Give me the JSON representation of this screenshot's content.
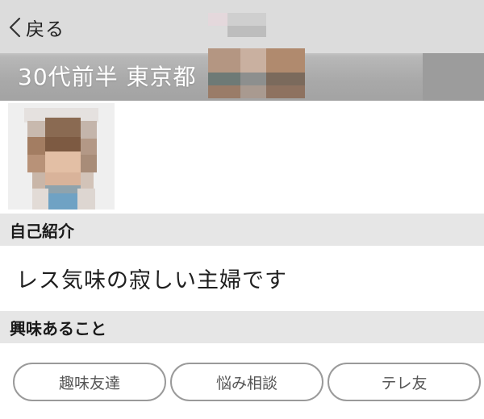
{
  "header": {
    "back_label": "戻る",
    "profile_title": "30代前半 東京都"
  },
  "sections": {
    "intro_heading": "自己紹介",
    "intro_text": "レス気味の寂しい主婦です",
    "interests_heading": "興味あること"
  },
  "interests": [
    "趣味友達",
    "悩み相談",
    "テレ友"
  ],
  "colors": {
    "header_bg": "#d9d9d9",
    "section_bg": "#e6e6e6",
    "tag_border": "#9a9a9a",
    "tag_text": "#555555"
  },
  "icons": {
    "back": "chevron-left-icon"
  }
}
